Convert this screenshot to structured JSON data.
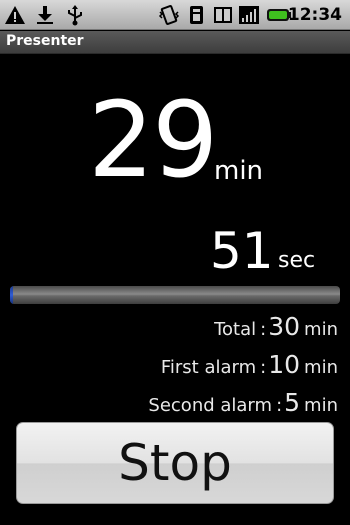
{
  "status_bar": {
    "icons": [
      "warning-icon",
      "download-icon",
      "usb-icon",
      "vibrate-icon",
      "sim-icon",
      "phone-icon",
      "signal-icon",
      "battery-icon"
    ],
    "time": "12:34",
    "battery_color": "#3fbf1f"
  },
  "app": {
    "title": "Presenter"
  },
  "timer": {
    "minutes": "29",
    "minutes_unit": "min",
    "seconds": "51",
    "seconds_unit": "sec",
    "progress": 0.01,
    "progress_color": "#2f5cd6"
  },
  "settings": [
    {
      "label": "Total",
      "colon": ":",
      "value": "30",
      "unit": "min"
    },
    {
      "label": "First alarm",
      "colon": ":",
      "value": "10",
      "unit": "min"
    },
    {
      "label": "Second alarm",
      "colon": ":",
      "value": "5",
      "unit": "min"
    }
  ],
  "stop_button": {
    "label": "Stop"
  }
}
